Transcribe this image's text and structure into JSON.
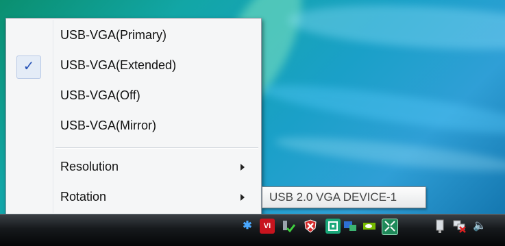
{
  "menu": {
    "items": [
      {
        "label": "USB-VGA(Primary)",
        "checked": false
      },
      {
        "label": "USB-VGA(Extended)",
        "checked": true
      },
      {
        "label": "USB-VGA(Off)",
        "checked": false
      },
      {
        "label": "USB-VGA(Mirror)",
        "checked": false
      },
      {
        "label": "Resolution",
        "submenu": true
      },
      {
        "label": "Rotation",
        "submenu": true
      }
    ],
    "check_glyph": "✓"
  },
  "tooltip": {
    "text": "USB 2.0 VGA DEVICE-1"
  },
  "tray": {
    "icons": [
      "bluetooth-icon",
      "vga-device-icon",
      "network-check-icon",
      "security-alert-icon",
      "sync-icon",
      "display-icon",
      "nvidia-icon",
      "screen-resize-icon",
      "power-plug-icon",
      "network-disconnected-icon",
      "volume-icon"
    ],
    "bluetooth_glyph": "✱",
    "vga_glyph": "VI",
    "volume_glyph": "🔈"
  },
  "colors": {
    "checkmark": "#2a56b8",
    "desktop": "#1aa0c8"
  }
}
